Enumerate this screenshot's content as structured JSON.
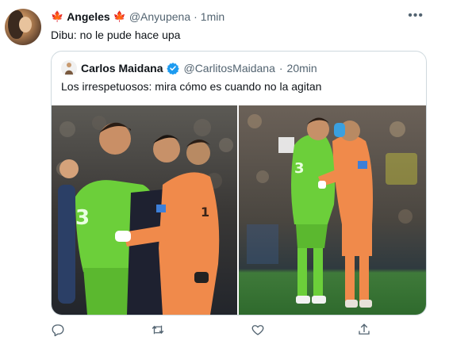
{
  "tweet": {
    "name": "Angeles",
    "name_emoji": "🍁",
    "handle": "@Anyupena",
    "separator": "·",
    "time": "1min",
    "more_label": "•••",
    "text": "Dibu: no le pude hace upa"
  },
  "quoted": {
    "name": "Carlos Maidana",
    "handle": "@CarlitosMaidana",
    "separator": "·",
    "time": "20min",
    "text": "Los irrespetuosos: mira cómo es cuando no la agitan",
    "verified_color": "#1d9bf0",
    "jersey_number": "1"
  },
  "colors": {
    "accent": "#1d9bf0",
    "muted": "#536471",
    "border": "#cfd9de",
    "green_kit": "#6ccf3a",
    "orange_kit": "#f08a4b"
  },
  "actions": [
    {
      "name": "reply",
      "icon": "reply-icon"
    },
    {
      "name": "retweet",
      "icon": "retweet-icon"
    },
    {
      "name": "like",
      "icon": "heart-icon"
    },
    {
      "name": "share",
      "icon": "share-icon"
    }
  ]
}
